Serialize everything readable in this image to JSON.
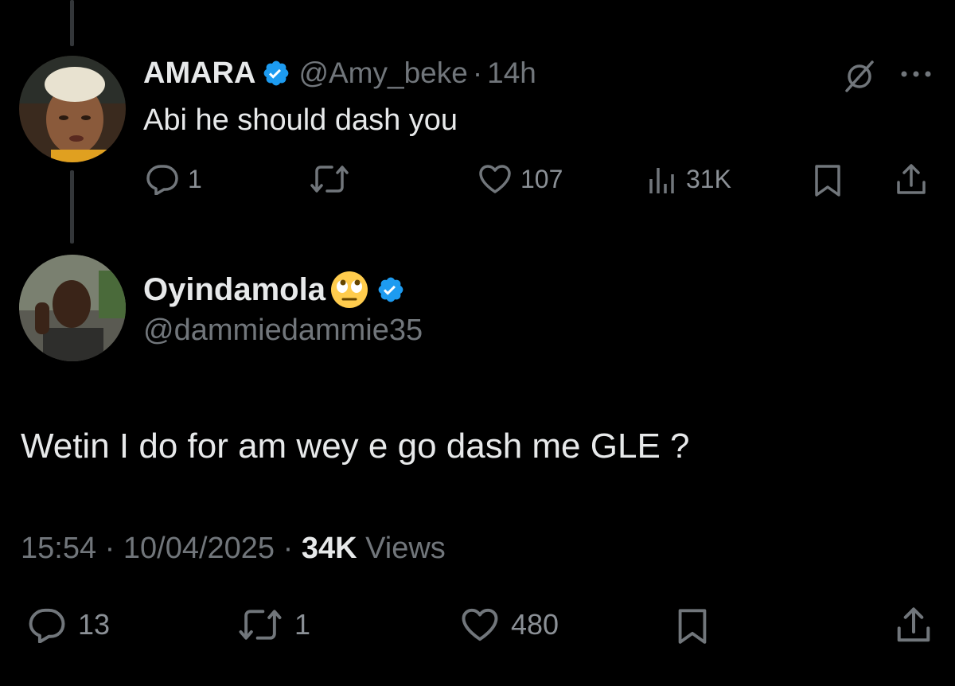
{
  "reply": {
    "display_name": "AMARA",
    "handle": "@Amy_beke",
    "separator": "·",
    "time": "14h",
    "text": "Abi he should dash you",
    "actions": {
      "replies": "1",
      "reposts": "",
      "likes": "107",
      "views": "31K"
    }
  },
  "tweet": {
    "display_name": "Oyindamola",
    "handle": "@dammiedammie35",
    "text": "Wetin I do for am wey e go dash me GLE ?",
    "time": "15:54",
    "separator": "·",
    "date": "10/04/2025",
    "views_count": "34K",
    "views_label": "Views",
    "actions": {
      "replies": "13",
      "reposts": "1",
      "likes": "480"
    }
  },
  "colors": {
    "background": "#000000",
    "primary_text": "#e7e9ea",
    "secondary_text": "#71767b",
    "verified_blue": "#1d9bf0",
    "thread_line": "#333639"
  },
  "icons": [
    "grok-icon",
    "more-icon",
    "reply-icon",
    "retweet-icon",
    "like-icon",
    "views-icon",
    "bookmark-icon",
    "share-icon",
    "verified-icon",
    "eye-roll-emoji"
  ]
}
